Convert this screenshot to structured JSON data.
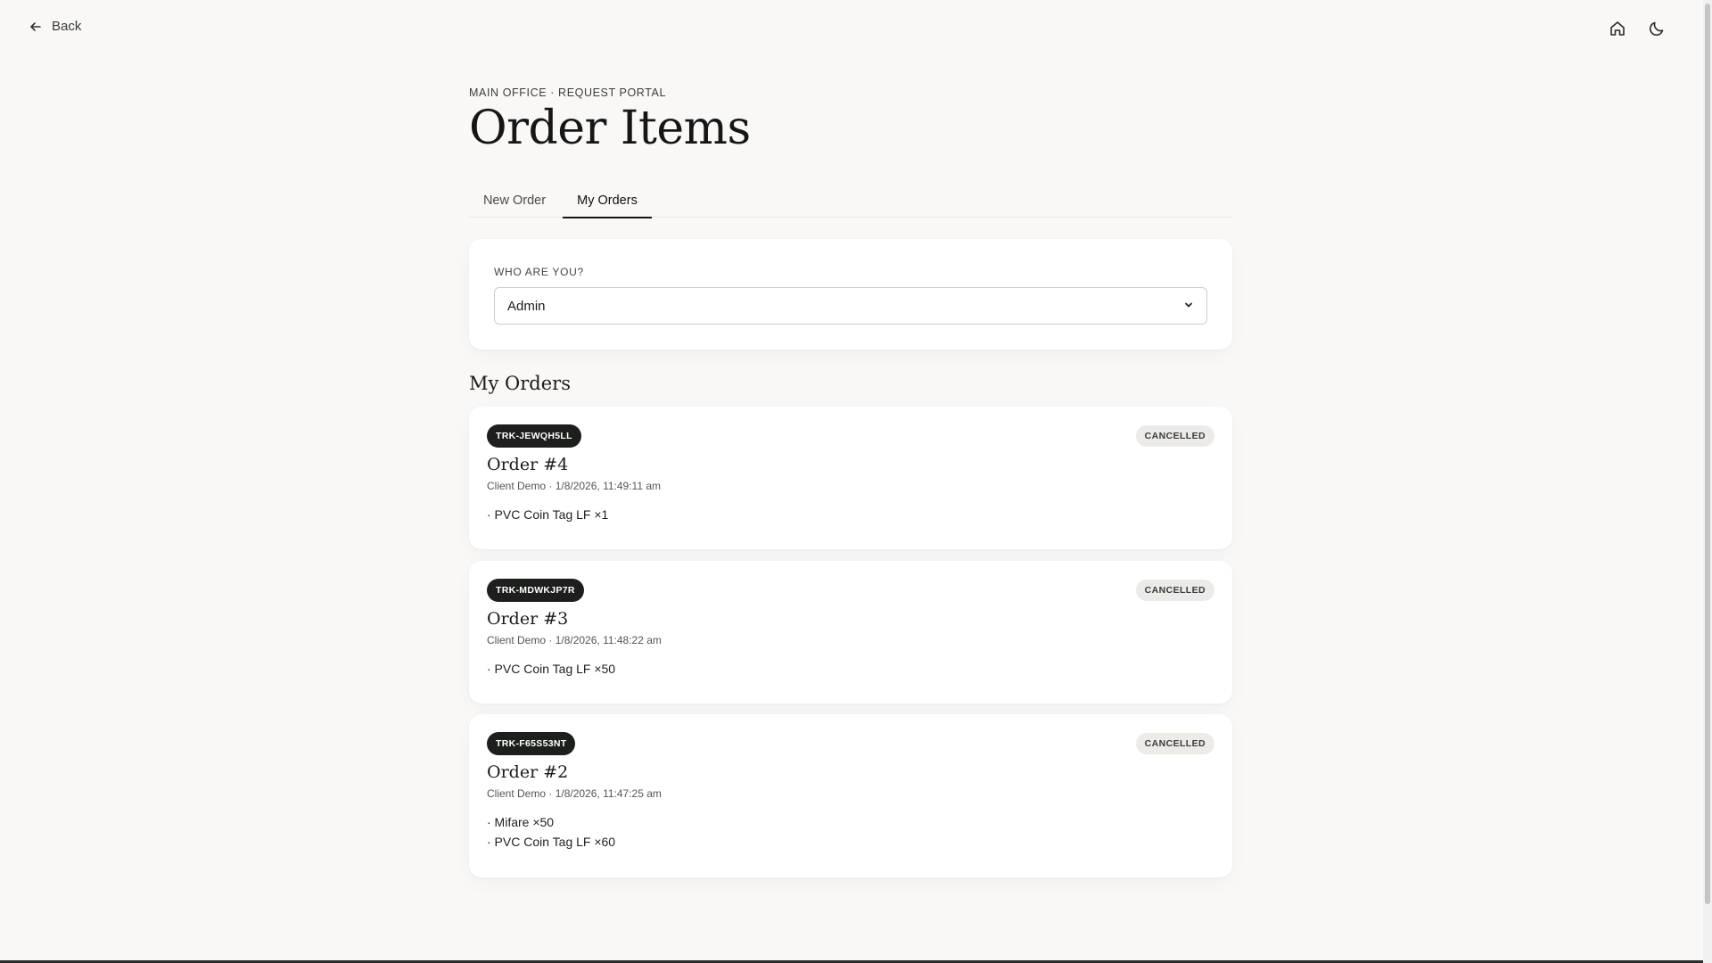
{
  "topbar": {
    "back_label": "Back",
    "icons": [
      "home-icon",
      "moon-icon"
    ]
  },
  "header": {
    "eyebrow": "MAIN OFFICE · REQUEST PORTAL",
    "title": "Order Items"
  },
  "tabs": [
    {
      "label": "New Order",
      "active": false
    },
    {
      "label": "My Orders",
      "active": true
    }
  ],
  "who": {
    "label": "WHO ARE YOU?",
    "selected": "Admin"
  },
  "orders_section": {
    "title": "My Orders",
    "orders": [
      {
        "tracking": "TRK-JEWQH5LL",
        "status": "CANCELLED",
        "title": "Order #4",
        "meta": "Client Demo · 1/8/2026, 11:49:11 am",
        "items": [
          "· PVC Coin Tag LF ×1"
        ]
      },
      {
        "tracking": "TRK-MDWKJP7R",
        "status": "CANCELLED",
        "title": "Order #3",
        "meta": "Client Demo · 1/8/2026, 11:48:22 am",
        "items": [
          "· PVC Coin Tag LF ×50"
        ]
      },
      {
        "tracking": "TRK-F65S53NT",
        "status": "CANCELLED",
        "title": "Order #2",
        "meta": "Client Demo · 1/8/2026, 11:47:25 am",
        "items": [
          "· Mifare ×50",
          "· PVC Coin Tag LF ×60"
        ]
      }
    ]
  },
  "colors": {
    "background": "#f9f8f6",
    "card": "#ffffff",
    "badge_dark": "#1d1f1d",
    "status_badge": "#ecebe8"
  }
}
